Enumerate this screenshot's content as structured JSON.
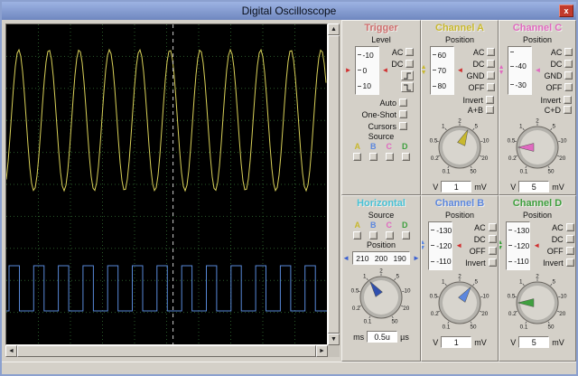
{
  "window": {
    "title": "Digital Oscilloscope",
    "close": "x"
  },
  "colors": {
    "channel_a": "#c8b82e",
    "channel_b": "#5c87de",
    "channel_c": "#e06ac0",
    "channel_d": "#3fa03f",
    "trigger_title": "#cf6f6f",
    "horizontal_title": "#49c2d6",
    "horizontal_knob": "#2f4fae",
    "marker_red": "#d03030"
  },
  "knob_labels": [
    "0.1",
    "0.2",
    "0.5",
    "1",
    "2",
    "5",
    "10",
    "20",
    "50"
  ],
  "scope": {
    "grid": {
      "cols": 10,
      "rows": 10,
      "color": "#2a5a2a"
    },
    "cursor_x_frac": 0.52,
    "cursor_color": "#cccccc",
    "waves": [
      {
        "name": "channel-a-sine",
        "type": "sine",
        "color": "#d8d058",
        "cycles": 10.6,
        "center": 106,
        "amplitude": 78,
        "phase": -1.0
      },
      {
        "name": "channel-b-square",
        "type": "square",
        "color": "#5888d8",
        "cycles": 13,
        "center": 292,
        "amplitude": 25,
        "duty": 0.42
      }
    ]
  },
  "panels": {
    "trigger": {
      "title": "Trigger",
      "level_label": "Level",
      "slider": [
        "-10",
        "0",
        "10"
      ],
      "coupling": [
        "AC",
        "DC"
      ],
      "mode_rows": [
        "Auto",
        "One-Shot",
        "Cursors"
      ],
      "source_label": "Source",
      "source_channels": [
        "A",
        "B",
        "C",
        "D"
      ]
    },
    "horizontal": {
      "title": "Horizontal",
      "source_label": "Source",
      "source_channels": [
        "A",
        "B",
        "C",
        "D"
      ],
      "position_label": "Position",
      "slider": [
        "210",
        "200",
        "190"
      ],
      "knob_angle": -35,
      "unit_left": "ms",
      "value": "0.5u",
      "unit_right": "µs"
    },
    "channel_a": {
      "title": "Channel A",
      "position_label": "Position",
      "slider": [
        "60",
        "70",
        "80"
      ],
      "buttons": [
        "AC",
        "DC",
        "GND",
        "OFF"
      ],
      "invert_label": "Invert",
      "sum_label": "A+B",
      "knob_angle": 25,
      "unit_left": "V",
      "value": "1",
      "unit_right": "mV"
    },
    "channel_c": {
      "title": "Channel C",
      "position_label": "Position",
      "slider": [
        "",
        "-40",
        "-30"
      ],
      "buttons": [
        "AC",
        "DC",
        "GND",
        "OFF"
      ],
      "invert_label": "Invert",
      "sum_label": "C+D",
      "knob_angle": -90,
      "unit_left": "V",
      "value": "5",
      "unit_right": "mV"
    },
    "channel_b": {
      "title": "Channel B",
      "position_label": "Position",
      "slider": [
        "-130",
        "-120",
        "-110"
      ],
      "buttons": [
        "AC",
        "DC",
        "OFF"
      ],
      "invert_label": "Invert",
      "knob_angle": 35,
      "unit_left": "V",
      "value": "1",
      "unit_right": "mV"
    },
    "channel_d": {
      "title": "Channel D",
      "position_label": "Position",
      "slider": [
        "-130",
        "-120",
        "-110"
      ],
      "buttons": [
        "AC",
        "DC",
        "OFF"
      ],
      "invert_label": "Invert",
      "knob_angle": -90,
      "unit_left": "V",
      "value": "5",
      "unit_right": "mV"
    }
  },
  "scrollbar": {
    "left": "◄",
    "right": "►",
    "up": "▲",
    "down": "▼"
  }
}
